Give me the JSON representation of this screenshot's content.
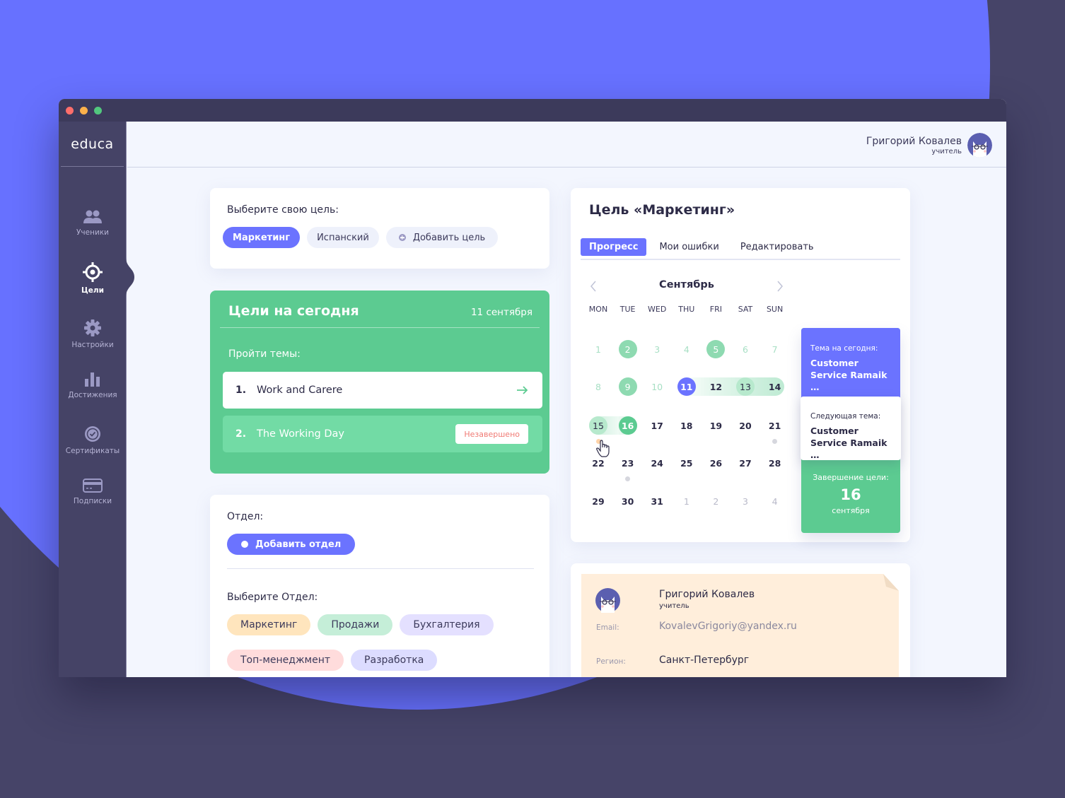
{
  "colors": {
    "accent": "#6b73ff",
    "green": "#5ccb91",
    "sidebar": "#454366",
    "titlebar": "#3c3a5b",
    "window_close": "#fd6e6b",
    "window_minimize": "#fdb14b",
    "window_maximize": "#52c77e",
    "incomplete_red": "#f07a74"
  },
  "app": {
    "logo": "educa"
  },
  "sidebar": {
    "items": [
      {
        "label": "Ученики",
        "icon": "users-icon",
        "active": false
      },
      {
        "label": "Цели",
        "icon": "target-icon",
        "active": true
      },
      {
        "label": "Настройки",
        "icon": "gear-icon",
        "active": false
      },
      {
        "label": "Достижения",
        "icon": "bar-chart-icon",
        "active": false
      },
      {
        "label": "Сертификаты",
        "icon": "certificate-icon",
        "active": false
      },
      {
        "label": "Подписки",
        "icon": "credit-card-icon",
        "active": false
      }
    ]
  },
  "header": {
    "user_name": "Григорий Ковалев",
    "user_role": "учитель"
  },
  "goal_selector": {
    "label": "Выберите свою цель:",
    "goals": [
      "Маркетинг",
      "Испанский"
    ],
    "selected": "Маркетинг",
    "add_label": "Добавить цель"
  },
  "today": {
    "title": "Цели на сегодня",
    "date": "11 сентября",
    "subtitle": "Пройти темы:",
    "topics": [
      {
        "num": "1.",
        "title": "Work and Carere",
        "status": "open"
      },
      {
        "num": "2.",
        "title": "The Working Day",
        "status": "Незавершено"
      }
    ]
  },
  "department": {
    "label": "Отдел:",
    "add_label": "Добавить отдел",
    "select_label": "Выберите Отдел:",
    "tags": [
      {
        "label": "Маркетинг",
        "color": "#ffe5bd"
      },
      {
        "label": "Продажи",
        "color": "#c5eed8"
      },
      {
        "label": "Бухгалтерия",
        "color": "#e4e0ff"
      },
      {
        "label": "Топ-менеджмент",
        "color": "#ffdcdc"
      },
      {
        "label": "Разработка",
        "color": "#dcdcff"
      }
    ]
  },
  "goal_card": {
    "title": "Цель «Маркетинг»",
    "tabs": [
      "Прогресс",
      "Мои ошибки",
      "Редактировать"
    ],
    "active_tab": "Прогресс",
    "calendar": {
      "month": "Сентябрь",
      "weekdays": [
        "MON",
        "TUE",
        "WED",
        "THU",
        "FRI",
        "SAT",
        "SUN"
      ],
      "weeks": [
        [
          {
            "d": "1",
            "s": "faded-green"
          },
          {
            "d": "2",
            "s": "done"
          },
          {
            "d": "3",
            "s": "faded-green"
          },
          {
            "d": "4",
            "s": "faded-green"
          },
          {
            "d": "5",
            "s": "done"
          },
          {
            "d": "6",
            "s": "faded-green"
          },
          {
            "d": "7",
            "s": "faded-green"
          }
        ],
        [
          {
            "d": "8",
            "s": "faded-green"
          },
          {
            "d": "9",
            "s": "done"
          },
          {
            "d": "10",
            "s": "faded-green"
          },
          {
            "d": "11",
            "s": "today"
          },
          {
            "d": "12",
            "s": "plain"
          },
          {
            "d": "13",
            "s": "range-mid"
          },
          {
            "d": "14",
            "s": "plain"
          }
        ],
        [
          {
            "d": "15",
            "s": "range-mid"
          },
          {
            "d": "16",
            "s": "goal-end"
          },
          {
            "d": "17",
            "s": "plain"
          },
          {
            "d": "18",
            "s": "plain"
          },
          {
            "d": "19",
            "s": "plain"
          },
          {
            "d": "20",
            "s": "plain"
          },
          {
            "d": "21",
            "s": "plain"
          }
        ],
        [
          {
            "d": "22",
            "s": "plain"
          },
          {
            "d": "23",
            "s": "plain"
          },
          {
            "d": "24",
            "s": "plain"
          },
          {
            "d": "25",
            "s": "plain"
          },
          {
            "d": "26",
            "s": "plain"
          },
          {
            "d": "27",
            "s": "plain"
          },
          {
            "d": "28",
            "s": "plain"
          }
        ],
        [
          {
            "d": "29",
            "s": "plain"
          },
          {
            "d": "30",
            "s": "plain"
          },
          {
            "d": "31",
            "s": "plain"
          },
          {
            "d": "1",
            "s": "faded-grey"
          },
          {
            "d": "2",
            "s": "faded-grey"
          },
          {
            "d": "3",
            "s": "faded-grey"
          },
          {
            "d": "4",
            "s": "faded-grey"
          }
        ]
      ],
      "event_dots": [
        {
          "day": "15",
          "color": "#ffd3a8"
        },
        {
          "day": "21",
          "color": "#d6d7de"
        },
        {
          "day": "23",
          "color": "#d6d7de"
        }
      ]
    },
    "today_topic": {
      "label": "Тема на сегодня:",
      "title": "Customer Service Ramaik …"
    },
    "next_topic": {
      "label": "Следующая тема:",
      "title": "Customer Service Ramaik …"
    },
    "goal_end": {
      "label": "Завершение цели:",
      "day": "16",
      "month": "сентября"
    }
  },
  "profile": {
    "name": "Григорий Ковалев",
    "role": "учитель",
    "email_label": "Email:",
    "email": "KovalevGrigoriy@yandex.ru",
    "region_label": "Регион:",
    "region": "Санкт-Петербург"
  }
}
